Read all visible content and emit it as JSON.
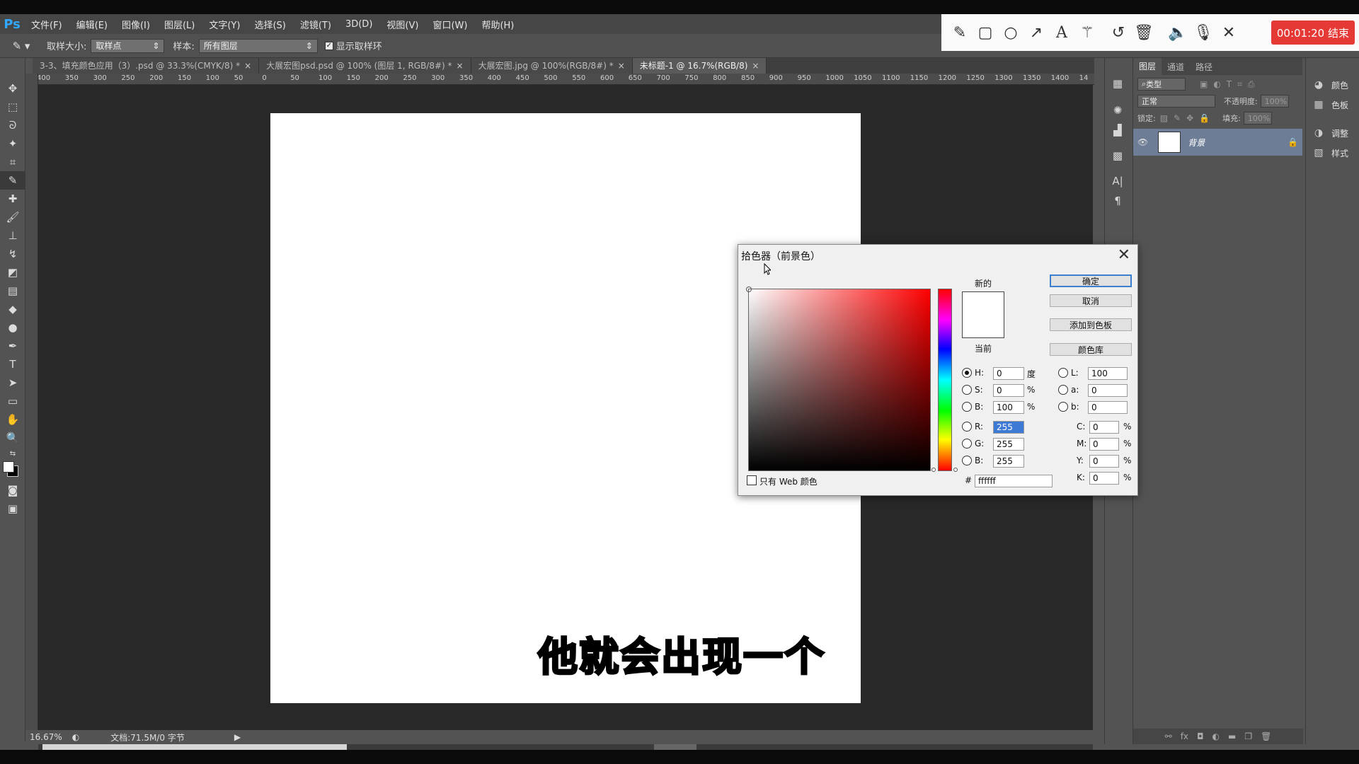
{
  "app": {
    "logo": "Ps"
  },
  "menu": [
    "文件(F)",
    "编辑(E)",
    "图像(I)",
    "图层(L)",
    "文字(Y)",
    "选择(S)",
    "滤镜(T)",
    "3D(D)",
    "视图(V)",
    "窗口(W)",
    "帮助(H)"
  ],
  "options": {
    "sample_size_label": "取样大小:",
    "sample_size_value": "取样点",
    "sample_label": "样本:",
    "sample_value": "所有图层",
    "show_ring_label": "显示取样环"
  },
  "recorder": {
    "icons": [
      "pencil-icon",
      "rectangle-icon",
      "circle-icon",
      "arrow-icon",
      "text-icon",
      "magic-wand-icon",
      "undo-icon",
      "trash-icon",
      "speaker-icon",
      "microphone-icon",
      "close-icon"
    ],
    "timer": "00:01:20 结束"
  },
  "tabs": [
    {
      "label": "3-3、填充颜色应用（3）.psd @ 33.3%(CMYK/8) *",
      "close": "×"
    },
    {
      "label": "大展宏图psd.psd @ 100% (图层 1, RGB/8#) *",
      "close": "×"
    },
    {
      "label": "大展宏图.jpg @ 100%(RGB/8#) *",
      "close": "×"
    },
    {
      "label": "未标题-1 @ 16.7%(RGB/8)",
      "close": "×"
    }
  ],
  "ruler_h": [
    "400",
    "350",
    "300",
    "250",
    "200",
    "150",
    "100",
    "50",
    "0",
    "50",
    "100",
    "150",
    "200",
    "250",
    "300",
    "350",
    "400",
    "450",
    "500",
    "550",
    "600",
    "650",
    "700",
    "750",
    "800",
    "850",
    "900",
    "950",
    "1000",
    "1050",
    "1100",
    "1150",
    "1200",
    "1250",
    "1300",
    "1350",
    "1400",
    "14"
  ],
  "subtitle": "他就会出现一个",
  "status": {
    "zoom": "16.67%",
    "doc": "文档:71.5M/0 字节"
  },
  "layers_panel": {
    "tabs": [
      "图层",
      "通道",
      "路径"
    ],
    "filter_label": "类型",
    "blend_mode": "正常",
    "opacity_label": "不透明度:",
    "opacity_value": "100%",
    "lock_label": "锁定:",
    "fill_label": "填充:",
    "fill_value": "100%",
    "layer_name": "背景"
  },
  "side_panel": [
    "颜色",
    "色板",
    "调整",
    "样式"
  ],
  "picker": {
    "title": "拾色器（前景色）",
    "new_label": "新的",
    "current_label": "当前",
    "ok": "确定",
    "cancel": "取消",
    "add_swatch": "添加到色板",
    "color_lib": "颜色库",
    "H_label": "H:",
    "H": "0",
    "H_unit": "度",
    "S_label": "S:",
    "S": "0",
    "S_unit": "%",
    "B_label": "B:",
    "B": "100",
    "B_unit": "%",
    "R_label": "R:",
    "R": "255",
    "G_label": "G:",
    "G": "255",
    "Bl_label": "B:",
    "Bl": "255",
    "L_label": "L:",
    "L": "100",
    "a_label": "a:",
    "a": "0",
    "b_label": "b:",
    "b": "0",
    "C_label": "C:",
    "C": "0",
    "M_label": "M:",
    "M": "0",
    "Y_label": "Y:",
    "Y": "0",
    "K_label": "K:",
    "K": "0",
    "pct": "%",
    "hex_label": "#",
    "hex": "ffffff",
    "web_only_label": "只有 Web 颜色"
  }
}
